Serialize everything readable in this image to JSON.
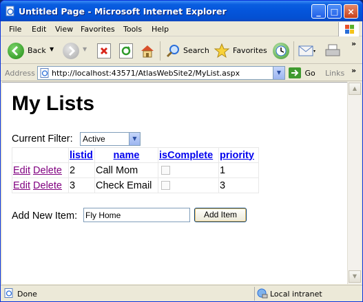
{
  "window": {
    "title": "Untitled Page - Microsoft Internet Explorer",
    "minimize": "_",
    "maximize": "□",
    "close": "×"
  },
  "menu": [
    "File",
    "Edit",
    "View",
    "Favorites",
    "Tools",
    "Help"
  ],
  "toolbar": {
    "back": "Back",
    "search": "Search",
    "favorites": "Favorites"
  },
  "address": {
    "label": "Address",
    "url": "http://localhost:43571/AtlasWebSite2/MyList.aspx",
    "go": "Go",
    "links": "Links"
  },
  "page": {
    "heading": "My Lists",
    "filter_label": "Current Filter:",
    "filter_value": "Active",
    "columns": [
      "listid",
      "name",
      "isComplete",
      "priority"
    ],
    "rows": [
      {
        "edit": "Edit",
        "delete": "Delete",
        "listid": "2",
        "name": "Call Mom",
        "isComplete": false,
        "priority": "1"
      },
      {
        "edit": "Edit",
        "delete": "Delete",
        "listid": "3",
        "name": "Check Email",
        "isComplete": false,
        "priority": "3"
      }
    ],
    "add_label": "Add New Item:",
    "add_value": "Fly Home",
    "add_button": "Add Item"
  },
  "status": {
    "text": "Done",
    "zone": "Local intranet"
  },
  "colors": {
    "titlebar": "#0455db",
    "link": "#0000ee",
    "visited_link": "#800080"
  }
}
